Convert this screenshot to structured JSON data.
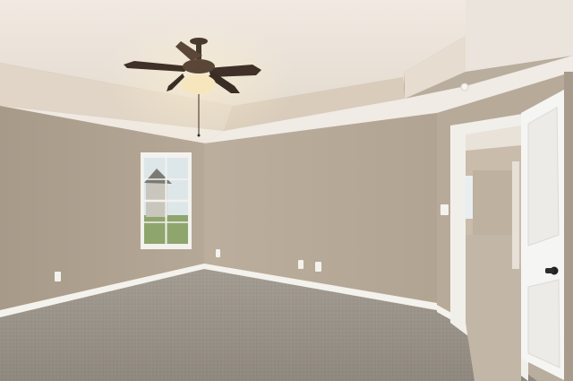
{
  "scene": {
    "subject": "empty-bedroom-interior",
    "colors": {
      "wall": "#b3a595",
      "wall_shadow": "#a39684",
      "ceiling": "#ebe4dc",
      "tray_ceiling": "#e3d9cc",
      "carpet": "#9a9389",
      "baseboard": "#f2f0ea",
      "door": "#f4f4f2",
      "trim": "#f1efea",
      "fan_blade": "#4a3a2e",
      "fan_light": "#f5e2b6",
      "window_glass": "#dbe6ea",
      "hallway_wall": "#c9bcab",
      "hallway_carpet": "#c1b6a6"
    },
    "icons": {
      "fan": "ceiling-fan-icon",
      "window": "window-icon",
      "door": "door-icon",
      "outlet": "outlet-icon",
      "switch": "light-switch-icon",
      "knob": "door-knob-icon"
    }
  }
}
